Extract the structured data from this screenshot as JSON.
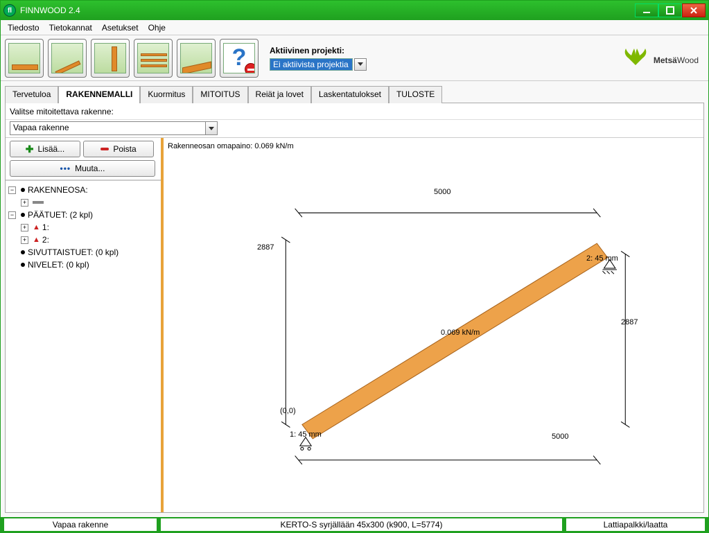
{
  "window": {
    "title": "FINNWOOD 2.4",
    "icon_letters": "fl"
  },
  "menu": {
    "tiedosto": "Tiedosto",
    "tietokannat": "Tietokannat",
    "asetukset": "Asetukset",
    "ohje": "Ohje"
  },
  "toolbar": {
    "project_label": "Aktiivinen projekti:",
    "project_value": "Ei aktiivista projektia",
    "brand_a": "Metsä",
    "brand_b": "Wood"
  },
  "tabs": {
    "tervetuloa": "Tervetuloa",
    "rakennemalli": "RAKENNEMALLI",
    "kuormitus": "Kuormitus",
    "mitoitus": "MITOITUS",
    "reiat": "Reiät ja lovet",
    "laskenta": "Laskentatulokset",
    "tuloste": "TULOSTE"
  },
  "panel": {
    "select_label": "Valitse mitoitettava rakenne:",
    "structure_value": "Vapaa rakenne",
    "btn_add": "Lisää...",
    "btn_del": "Poista",
    "btn_edit": "Muuta..."
  },
  "tree": {
    "rakenneosa": "RAKENNEOSA:",
    "paatuet": "PÄÄTUET: (2 kpl)",
    "t1": "1:",
    "t2": "2:",
    "sivut": "SIVUTTAISTUET: (0 kpl)",
    "nivel": "NIVELET: (0 kpl)"
  },
  "canvas": {
    "omapaino": "Rakenneosan omapaino: 0.069 kN/m",
    "dim_top": "5000",
    "dim_bottom": "5000",
    "dim_left": "2887",
    "dim_right": "2887",
    "load_label": "0.069 kN/m",
    "origin": "(0,0)",
    "support1": "1: 45 mm",
    "support2": "2: 45 mm"
  },
  "status": {
    "left": "Vapaa rakenne",
    "mid": "KERTO-S syrjällään 45x300 (k900, L=5774)",
    "right": "Lattiapalkki/laatta"
  }
}
